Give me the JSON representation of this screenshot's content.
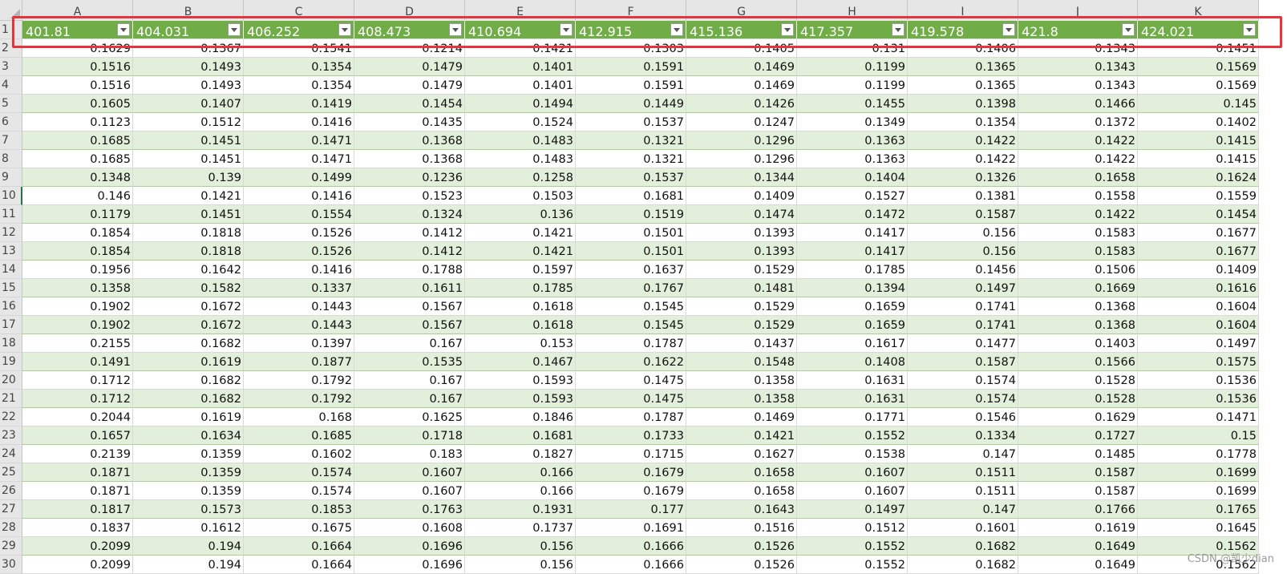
{
  "sheet": {
    "columns": [
      "A",
      "B",
      "C",
      "D",
      "E",
      "F",
      "G",
      "H",
      "I",
      "J",
      "K"
    ],
    "headers": [
      "401.81",
      "404.031",
      "406.252",
      "408.473",
      "410.694",
      "412.915",
      "415.136",
      "417.357",
      "419.578",
      "421.8",
      "424.021"
    ],
    "row_numbers": [
      "1",
      "2",
      "3",
      "4",
      "5",
      "6",
      "7",
      "8",
      "9",
      "10",
      "11",
      "12",
      "13",
      "14",
      "15",
      "16",
      "17",
      "18",
      "19",
      "20",
      "21",
      "22",
      "23",
      "24",
      "25",
      "26",
      "27",
      "28",
      "29",
      "30"
    ],
    "rows": [
      [
        "0.1629",
        "0.1367",
        "0.1541",
        "0.1214",
        "0.1421",
        "0.1303",
        "0.1405",
        "0.131",
        "0.1406",
        "0.1343",
        "0.1451"
      ],
      [
        "0.1516",
        "0.1493",
        "0.1354",
        "0.1479",
        "0.1401",
        "0.1591",
        "0.1469",
        "0.1199",
        "0.1365",
        "0.1343",
        "0.1569"
      ],
      [
        "0.1516",
        "0.1493",
        "0.1354",
        "0.1479",
        "0.1401",
        "0.1591",
        "0.1469",
        "0.1199",
        "0.1365",
        "0.1343",
        "0.1569"
      ],
      [
        "0.1605",
        "0.1407",
        "0.1419",
        "0.1454",
        "0.1494",
        "0.1449",
        "0.1426",
        "0.1455",
        "0.1398",
        "0.1466",
        "0.145"
      ],
      [
        "0.1123",
        "0.1512",
        "0.1416",
        "0.1435",
        "0.1524",
        "0.1537",
        "0.1247",
        "0.1349",
        "0.1354",
        "0.1372",
        "0.1402"
      ],
      [
        "0.1685",
        "0.1451",
        "0.1471",
        "0.1368",
        "0.1483",
        "0.1321",
        "0.1296",
        "0.1363",
        "0.1422",
        "0.1422",
        "0.1415"
      ],
      [
        "0.1685",
        "0.1451",
        "0.1471",
        "0.1368",
        "0.1483",
        "0.1321",
        "0.1296",
        "0.1363",
        "0.1422",
        "0.1422",
        "0.1415"
      ],
      [
        "0.1348",
        "0.139",
        "0.1499",
        "0.1236",
        "0.1258",
        "0.1537",
        "0.1344",
        "0.1404",
        "0.1326",
        "0.1658",
        "0.1624"
      ],
      [
        "0.146",
        "0.1421",
        "0.1416",
        "0.1523",
        "0.1503",
        "0.1681",
        "0.1409",
        "0.1527",
        "0.1381",
        "0.1558",
        "0.1559"
      ],
      [
        "0.1179",
        "0.1451",
        "0.1554",
        "0.1324",
        "0.136",
        "0.1519",
        "0.1474",
        "0.1472",
        "0.1587",
        "0.1422",
        "0.1454"
      ],
      [
        "0.1854",
        "0.1818",
        "0.1526",
        "0.1412",
        "0.1421",
        "0.1501",
        "0.1393",
        "0.1417",
        "0.156",
        "0.1583",
        "0.1677"
      ],
      [
        "0.1854",
        "0.1818",
        "0.1526",
        "0.1412",
        "0.1421",
        "0.1501",
        "0.1393",
        "0.1417",
        "0.156",
        "0.1583",
        "0.1677"
      ],
      [
        "0.1956",
        "0.1642",
        "0.1416",
        "0.1788",
        "0.1597",
        "0.1637",
        "0.1529",
        "0.1785",
        "0.1456",
        "0.1506",
        "0.1409"
      ],
      [
        "0.1358",
        "0.1582",
        "0.1337",
        "0.1611",
        "0.1785",
        "0.1767",
        "0.1481",
        "0.1394",
        "0.1497",
        "0.1669",
        "0.1616"
      ],
      [
        "0.1902",
        "0.1672",
        "0.1443",
        "0.1567",
        "0.1618",
        "0.1545",
        "0.1529",
        "0.1659",
        "0.1741",
        "0.1368",
        "0.1604"
      ],
      [
        "0.1902",
        "0.1672",
        "0.1443",
        "0.1567",
        "0.1618",
        "0.1545",
        "0.1529",
        "0.1659",
        "0.1741",
        "0.1368",
        "0.1604"
      ],
      [
        "0.2155",
        "0.1682",
        "0.1397",
        "0.167",
        "0.153",
        "0.1787",
        "0.1437",
        "0.1617",
        "0.1477",
        "0.1403",
        "0.1497"
      ],
      [
        "0.1491",
        "0.1619",
        "0.1877",
        "0.1535",
        "0.1467",
        "0.1622",
        "0.1548",
        "0.1408",
        "0.1587",
        "0.1566",
        "0.1575"
      ],
      [
        "0.1712",
        "0.1682",
        "0.1792",
        "0.167",
        "0.1593",
        "0.1475",
        "0.1358",
        "0.1631",
        "0.1574",
        "0.1528",
        "0.1536"
      ],
      [
        "0.1712",
        "0.1682",
        "0.1792",
        "0.167",
        "0.1593",
        "0.1475",
        "0.1358",
        "0.1631",
        "0.1574",
        "0.1528",
        "0.1536"
      ],
      [
        "0.2044",
        "0.1619",
        "0.168",
        "0.1625",
        "0.1846",
        "0.1787",
        "0.1469",
        "0.1771",
        "0.1546",
        "0.1629",
        "0.1471"
      ],
      [
        "0.1657",
        "0.1634",
        "0.1685",
        "0.1718",
        "0.1681",
        "0.1733",
        "0.1421",
        "0.1552",
        "0.1334",
        "0.1727",
        "0.15"
      ],
      [
        "0.2139",
        "0.1359",
        "0.1602",
        "0.183",
        "0.1827",
        "0.1715",
        "0.1627",
        "0.1538",
        "0.147",
        "0.1485",
        "0.1778"
      ],
      [
        "0.1871",
        "0.1359",
        "0.1574",
        "0.1607",
        "0.166",
        "0.1679",
        "0.1658",
        "0.1607",
        "0.1511",
        "0.1587",
        "0.1699"
      ],
      [
        "0.1871",
        "0.1359",
        "0.1574",
        "0.1607",
        "0.166",
        "0.1679",
        "0.1658",
        "0.1607",
        "0.1511",
        "0.1587",
        "0.1699"
      ],
      [
        "0.1817",
        "0.1573",
        "0.1853",
        "0.1763",
        "0.1931",
        "0.177",
        "0.1643",
        "0.1497",
        "0.147",
        "0.1766",
        "0.1765"
      ],
      [
        "0.1837",
        "0.1612",
        "0.1675",
        "0.1608",
        "0.1737",
        "0.1691",
        "0.1516",
        "0.1512",
        "0.1601",
        "0.1619",
        "0.1645"
      ],
      [
        "0.2099",
        "0.194",
        "0.1664",
        "0.1696",
        "0.156",
        "0.1666",
        "0.1526",
        "0.1552",
        "0.1682",
        "0.1649",
        "0.1562"
      ],
      [
        "0.2099",
        "0.194",
        "0.1664",
        "0.1696",
        "0.156",
        "0.1666",
        "0.1526",
        "0.1552",
        "0.1682",
        "0.1649",
        "0.1562"
      ]
    ],
    "selected_row": "10"
  },
  "watermark": "CSDN @凯少dian",
  "colors": {
    "header_fill": "#70ad47",
    "band_fill": "#e2efda",
    "highlight_border": "#e8323c"
  }
}
